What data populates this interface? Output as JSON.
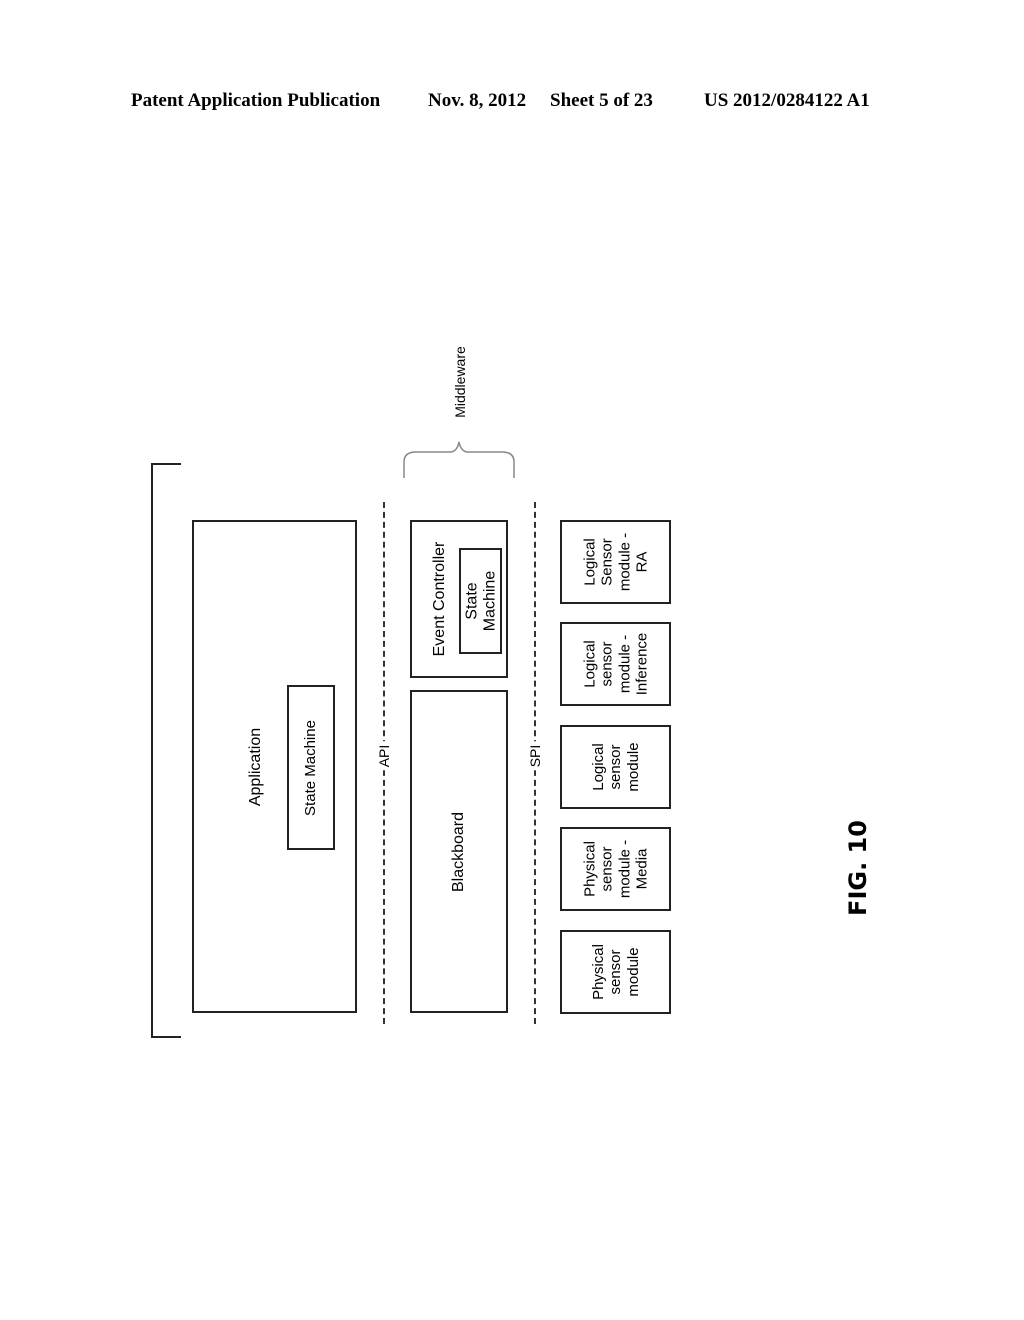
{
  "header": {
    "publication": "Patent Application Publication",
    "date": "Nov. 8, 2012",
    "sheet": "Sheet 5 of 23",
    "number": "US 2012/0284122 A1"
  },
  "diagram": {
    "middleware_label": "Middleware",
    "application": {
      "label": "Application",
      "state_machine": "State Machine"
    },
    "api_label": "API",
    "spi_label": "SPI",
    "event_controller": {
      "label": "Event Controller",
      "state_machine": "State Machine"
    },
    "blackboard": "Blackboard",
    "sensors": [
      {
        "label": "Logical Sensor module - RA"
      },
      {
        "label": "Logical sensor module - Inference"
      },
      {
        "label": "Logical sensor module"
      },
      {
        "label": "Physical sensor module - Media"
      },
      {
        "label": "Physical sensor module"
      }
    ],
    "sensor_lines": [
      [
        "Logical",
        "Sensor",
        "module -",
        "RA"
      ],
      [
        "Logical",
        "sensor",
        "module -",
        "Inference"
      ],
      [
        "Logical",
        "sensor",
        "module"
      ],
      [
        "Physical",
        "sensor",
        "module -",
        "Media"
      ],
      [
        "Physical",
        "sensor",
        "module"
      ]
    ]
  },
  "figure_label": "FIG. 10"
}
